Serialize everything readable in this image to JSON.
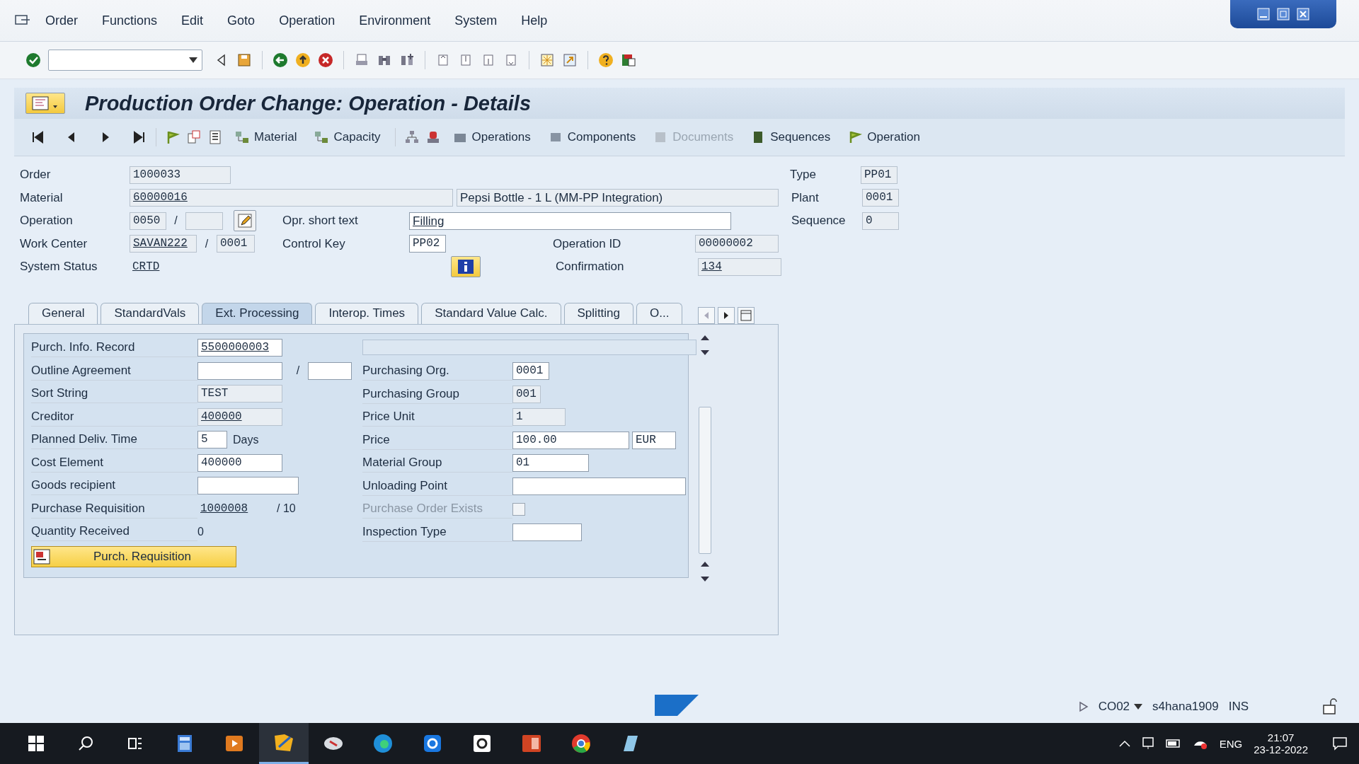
{
  "menu": [
    "Order",
    "Functions",
    "Edit",
    "Goto",
    "Operation",
    "Environment",
    "System",
    "Help"
  ],
  "title": "Production Order Change: Operation - Details",
  "app_toolbar": [
    {
      "label": "Material",
      "disabled": false
    },
    {
      "label": "Capacity",
      "disabled": false
    },
    {
      "label": "Operations",
      "disabled": false
    },
    {
      "label": "Components",
      "disabled": false
    },
    {
      "label": "Documents",
      "disabled": true
    },
    {
      "label": "Sequences",
      "disabled": false
    },
    {
      "label": "Operation",
      "disabled": false
    }
  ],
  "header": {
    "order": {
      "label": "Order",
      "value": "1000033",
      "editable": false,
      "underlined": false
    },
    "material": {
      "label": "Material",
      "value": "60000016",
      "editable": false,
      "underlined": true,
      "description": "Pepsi Bottle - 1 L (MM-PP Integration)"
    },
    "operation": {
      "label": "Operation",
      "value": "0050",
      "editable": false,
      "underlined": false,
      "separator": "/"
    },
    "short_text": {
      "label": "Opr. short text",
      "value": "Filling",
      "editable": true,
      "underlined": true
    },
    "work_center": {
      "label": "Work Center",
      "value": "SAVAN222",
      "editable": false,
      "underlined": true,
      "separator": "/",
      "second_value": "0001"
    },
    "control_key": {
      "label": "Control Key",
      "value": "PP02",
      "editable": true,
      "underlined": false
    },
    "operation_id": {
      "label": "Operation ID",
      "value": "00000002",
      "editable": false,
      "underlined": false
    },
    "system_status": {
      "label": "System Status",
      "value": "CRTD",
      "underlined": true
    },
    "confirmation": {
      "label": "Confirmation",
      "value": "134",
      "editable": false,
      "underlined": true
    },
    "type": {
      "label": "Type",
      "value": "PP01",
      "editable": false,
      "underlined": false
    },
    "plant": {
      "label": "Plant",
      "value": "0001",
      "editable": false,
      "underlined": false
    },
    "sequence": {
      "label": "Sequence",
      "value": "0",
      "editable": false,
      "underlined": false
    }
  },
  "tabs": [
    {
      "label": "General",
      "selected": false
    },
    {
      "label": "StandardVals",
      "selected": false
    },
    {
      "label": "Ext. Processing",
      "selected": true
    },
    {
      "label": "Interop. Times",
      "selected": false
    },
    {
      "label": "Standard Value Calc.",
      "selected": false
    },
    {
      "label": "Splitting",
      "selected": false
    },
    {
      "label": "O...",
      "selected": false
    }
  ],
  "left_rows": [
    {
      "label": "Purch. Info. Record",
      "disabled": false,
      "parts": [
        {
          "kind": "field",
          "value": "5500000003",
          "editable": true,
          "underlined": true
        }
      ]
    },
    {
      "label": "Outline Agreement",
      "disabled": false,
      "parts": [
        {
          "kind": "field",
          "editable": true
        },
        {
          "kind": "text",
          "value": "/"
        },
        {
          "kind": "field",
          "editable": true
        }
      ]
    },
    {
      "label": "Sort String",
      "disabled": false,
      "parts": [
        {
          "kind": "field",
          "value": "TEST",
          "editable": false,
          "underlined": false
        }
      ]
    },
    {
      "label": "Creditor",
      "disabled": false,
      "parts": [
        {
          "kind": "field",
          "value": "400000",
          "editable": false,
          "underlined": true
        }
      ]
    },
    {
      "label": "Planned Deliv. Time",
      "disabled": false,
      "parts": [
        {
          "kind": "field",
          "value": "5",
          "editable": true,
          "underlined": false
        },
        {
          "kind": "text",
          "value": "Days"
        }
      ]
    },
    {
      "label": "Cost Element",
      "disabled": false,
      "parts": [
        {
          "kind": "field",
          "value": "400000",
          "editable": true,
          "underlined": false
        }
      ]
    },
    {
      "label": "Goods recipient",
      "disabled": false,
      "parts": [
        {
          "kind": "field",
          "editable": true
        }
      ]
    },
    {
      "label": "Purchase Requisition",
      "disabled": false,
      "parts": [
        {
          "kind": "link",
          "value": "1000008"
        },
        {
          "kind": "text",
          "value": "/ 10"
        }
      ]
    },
    {
      "label": "Quantity Received",
      "disabled": false,
      "parts": [
        {
          "kind": "text",
          "value": "0"
        }
      ]
    }
  ],
  "requisition_button": "Purch. Requisition",
  "right_rows": [
    {
      "label": "Purchasing Org.",
      "disabled": false,
      "parts": [
        {
          "kind": "field",
          "value": "0001",
          "editable": true,
          "underlined": false
        }
      ]
    },
    {
      "label": "Purchasing Group",
      "disabled": false,
      "parts": [
        {
          "kind": "field",
          "value": "001",
          "editable": false,
          "underlined": false
        }
      ]
    },
    {
      "label": "Price Unit",
      "disabled": false,
      "parts": [
        {
          "kind": "field",
          "value": "1",
          "editable": false,
          "underlined": false
        }
      ]
    },
    {
      "label": "Price",
      "disabled": false,
      "parts": [
        {
          "kind": "field",
          "value": "100.00",
          "editable": true,
          "underlined": false
        },
        {
          "kind": "field",
          "value": "EUR",
          "editable": true,
          "underlined": false
        }
      ]
    },
    {
      "label": "Material Group",
      "disabled": false,
      "parts": [
        {
          "kind": "field",
          "value": "01",
          "editable": true,
          "underlined": false
        }
      ]
    },
    {
      "label": "Unloading Point",
      "disabled": false,
      "parts": [
        {
          "kind": "field",
          "editable": true
        }
      ]
    },
    {
      "label": "Purchase Order Exists",
      "disabled": true,
      "parts": [
        {
          "kind": "checkbox",
          "checked": false
        }
      ]
    },
    {
      "label": "Inspection Type",
      "disabled": false,
      "parts": [
        {
          "kind": "field",
          "editable": true
        }
      ]
    }
  ],
  "status_bar": {
    "transaction": "CO02",
    "system": "s4hana1909",
    "mode": "INS"
  },
  "taskbar": {
    "language": "ENG",
    "time": "21:07",
    "date": "23-12-2022"
  }
}
